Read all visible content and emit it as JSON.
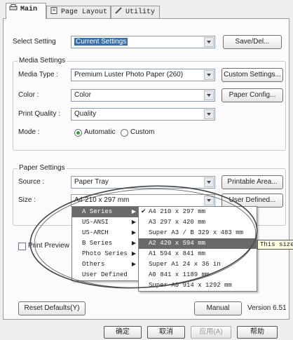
{
  "tabs": [
    {
      "label": "Main",
      "icon": "printer-icon",
      "active": true
    },
    {
      "label": "Page Layout",
      "icon": "page-icon",
      "active": false
    },
    {
      "label": "Utility",
      "icon": "pencil-icon",
      "active": false
    }
  ],
  "select_setting": {
    "label": "Select Setting",
    "value": "Current Settings",
    "save_button": "Save/Del..."
  },
  "media": {
    "title": "Media Settings",
    "media_type_label": "Media Type",
    "media_type_value": "Premium Luster Photo Paper (260)",
    "custom_button": "Custom Settings...",
    "color_label": "Color",
    "color_value": "Color",
    "paper_config_button": "Paper Config...",
    "quality_label": "Print Quality",
    "quality_value": "Quality",
    "mode_label": "Mode",
    "mode_options": [
      "Automatic",
      "Custom"
    ],
    "mode_selected": "Automatic"
  },
  "paper": {
    "title": "Paper Settings",
    "source_label": "Source",
    "source_value": "Paper Tray",
    "printable_button": "Printable Area...",
    "size_label": "Size",
    "size_value": "A4 210 x 297 mm",
    "user_defined_button": "User Defined..."
  },
  "print_preview": {
    "label": "Print Preview",
    "checked": false
  },
  "size_menu": {
    "categories": [
      {
        "label": "A Series",
        "has_submenu": true,
        "highlighted": true
      },
      {
        "label": "US-ANSI",
        "has_submenu": true
      },
      {
        "label": "US-ARCH",
        "has_submenu": true
      },
      {
        "label": "B Series",
        "has_submenu": true
      },
      {
        "label": "Photo Series",
        "has_submenu": true
      },
      {
        "label": "Others",
        "has_submenu": true
      },
      {
        "label": "User Defined",
        "has_submenu": false
      }
    ],
    "a_series": [
      {
        "label": "A4 210 x 297 mm",
        "checked": true
      },
      {
        "label": "A3 297 x 420 mm"
      },
      {
        "label": "Super A3 / B 329 x 483 mm"
      },
      {
        "label": "A2 420 x 594 mm",
        "highlighted": true
      },
      {
        "label": "A1 594 x 841 mm"
      },
      {
        "label": "Super A1 24 x 36 in"
      },
      {
        "label": "A0 841 x 1189 mm"
      },
      {
        "label": "Super A0 914 x 1292 mm"
      }
    ],
    "tooltip": "This size"
  },
  "bottom": {
    "reset_button": "Reset Defaults(Y)",
    "manual_button": "Manual",
    "version": "Version 6.51"
  },
  "dialog_buttons": [
    "确定",
    "取消",
    "应用(A)",
    "帮助"
  ],
  "dialog_buttons_disabled": [
    false,
    false,
    true,
    false
  ],
  "colors": {
    "selection": "#3a6ea5",
    "menu_highlight": "#6a6a6a",
    "radio_dot": "#3d9a3d",
    "annotation": "#444444"
  }
}
